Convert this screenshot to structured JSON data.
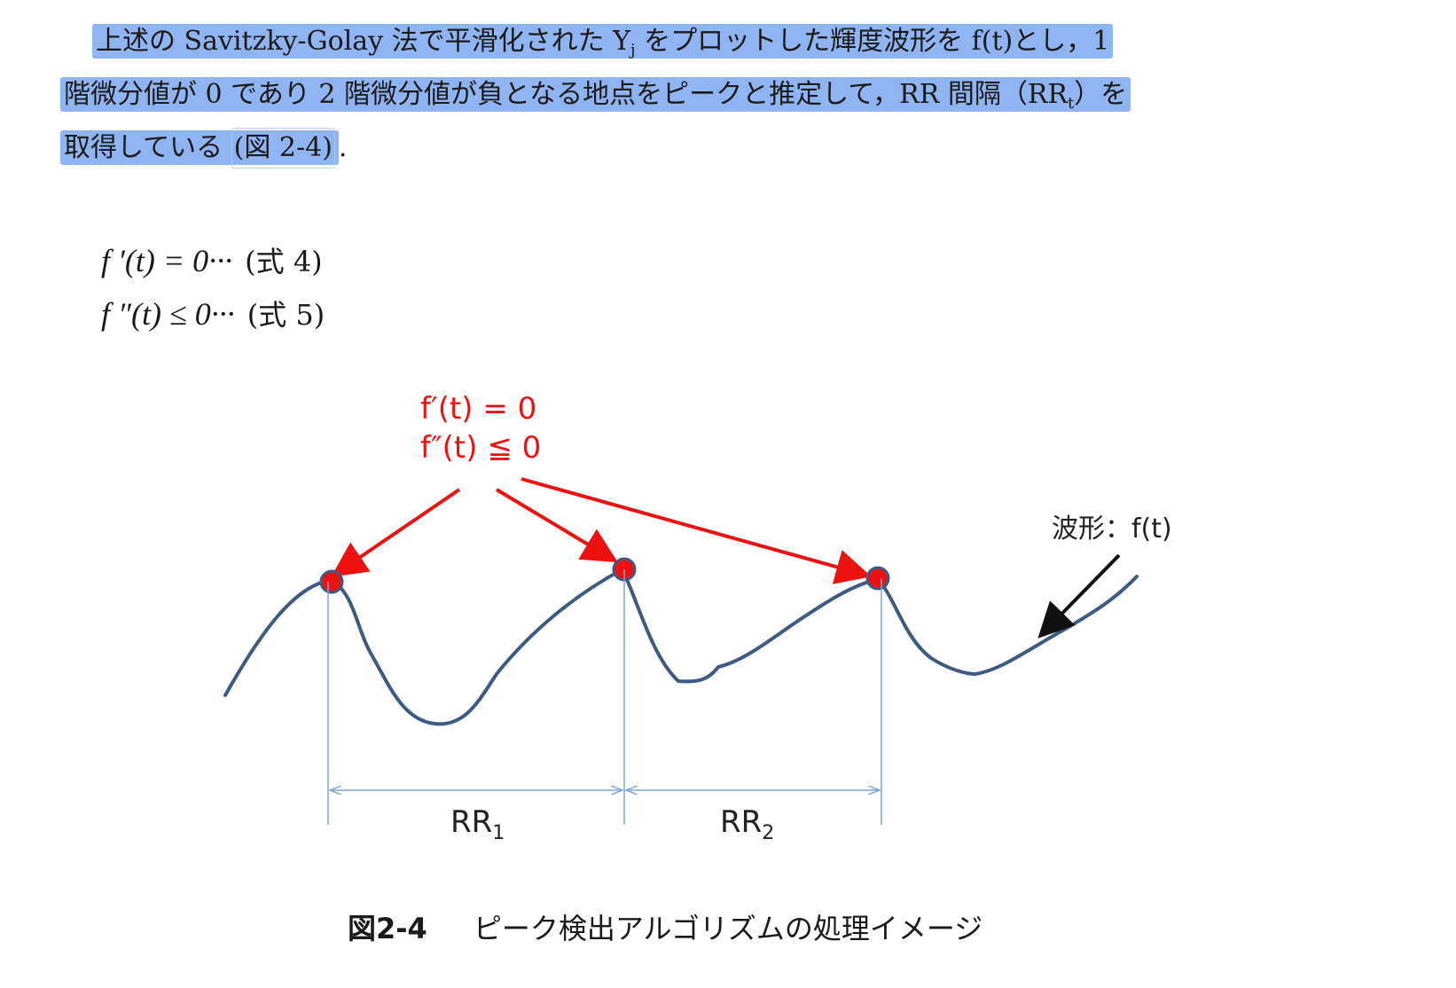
{
  "paragraph": {
    "line1": "上述の Savitzky-Golay 法で平滑化された Y",
    "line1_sub": "j",
    "line1_rest": " をプロットした輝度波形を f(t)とし，1",
    "line2": "階微分値が 0 であり 2 階微分値が負となる地点をピークと推定して，RR 間隔（RR",
    "line2_sub": "t",
    "line2_rest": "）を",
    "line3": "取得している",
    "line3_figref": "(図 2-4)",
    "line3_end": "."
  },
  "equations": {
    "eq4": {
      "lhs": "f ′(t) = 0···",
      "tag": "(式 4)"
    },
    "eq5": {
      "lhs": "f ″(t) ≤ 0···",
      "tag": "(式 5)"
    }
  },
  "figure": {
    "condition_line1": "f′(t) = 0",
    "condition_line2": "f″(t) ≦ 0",
    "waveform_label": "波形：f(t)",
    "rr1_label": "RR",
    "rr1_sub": "1",
    "rr2_label": "RR",
    "rr2_sub": "2",
    "colors": {
      "waveform": "#3e5a80",
      "arrow_red": "#ee1111",
      "peak_fill": "#ee1111",
      "dimension_line": "#7fa6d6",
      "highlight": "#8fb4f2"
    }
  },
  "caption": {
    "number": "図2-4",
    "title": "ピーク検出アルゴリズムの処理イメージ"
  }
}
